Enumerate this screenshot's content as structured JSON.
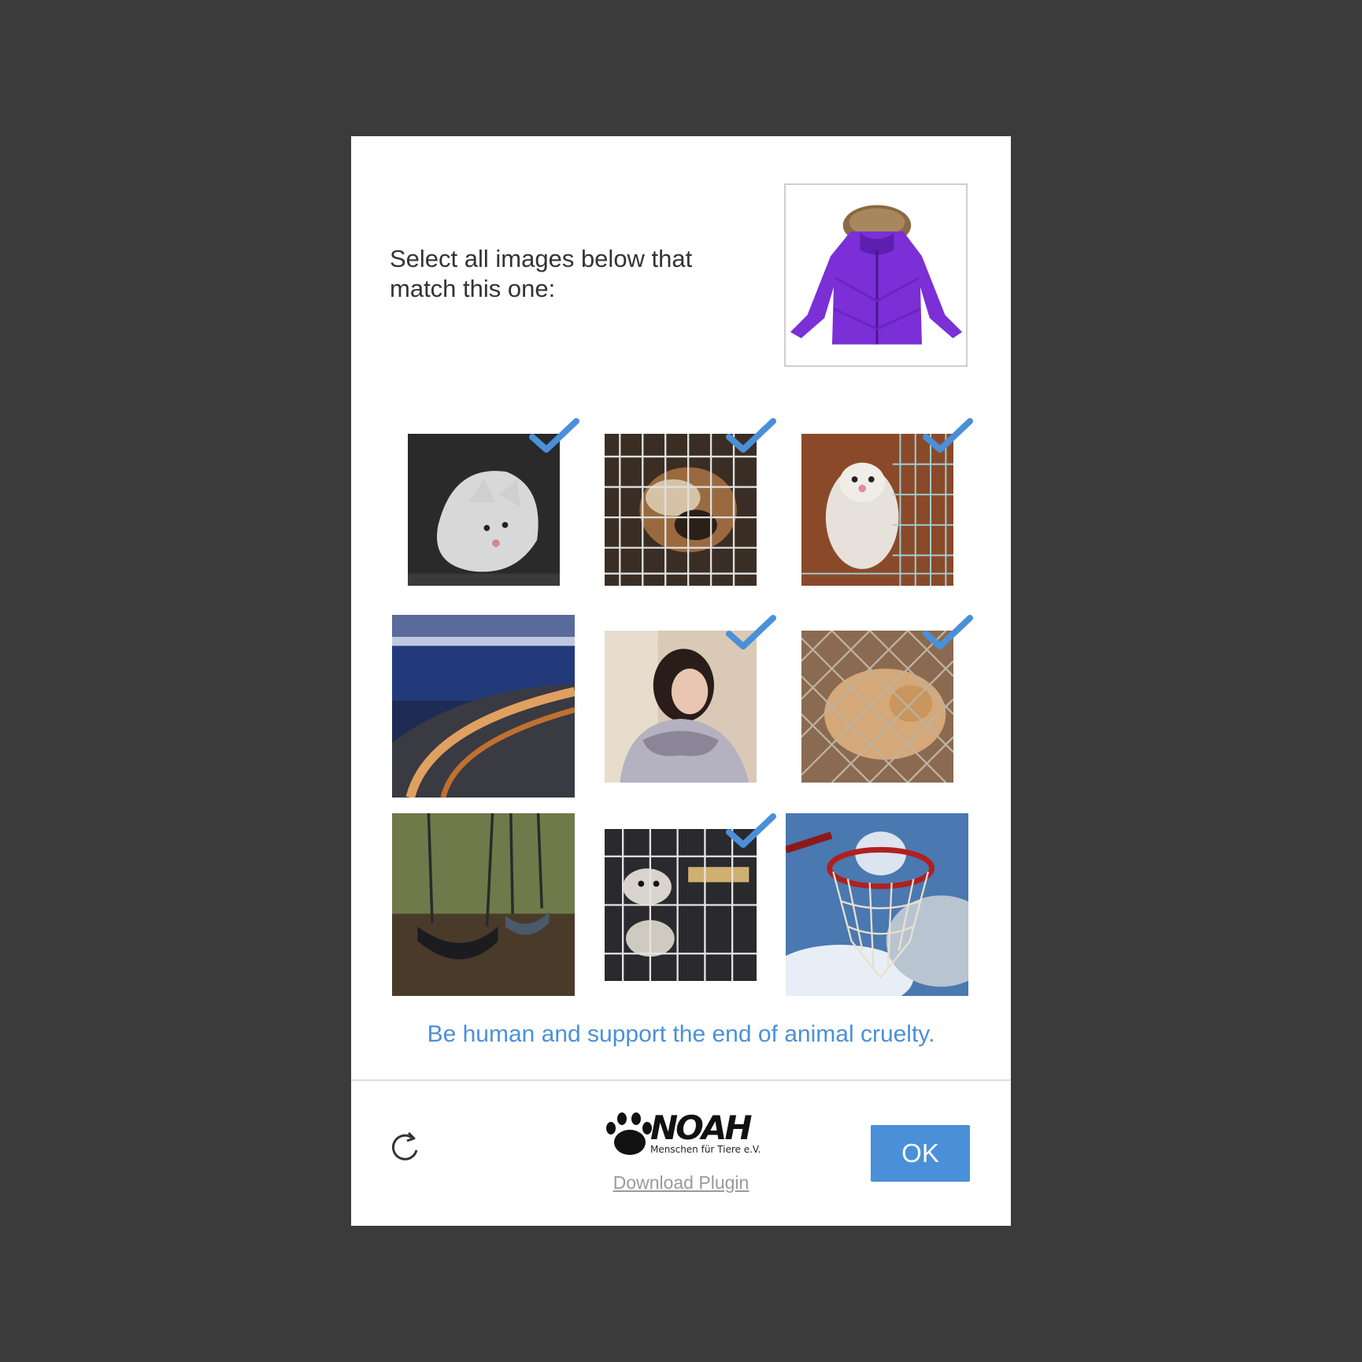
{
  "prompt": {
    "text": "Select all images below that match this one:"
  },
  "reference_image": {
    "subject": "purple-jacket-with-fur-hood",
    "icon": "jacket-icon"
  },
  "grid": {
    "tiles": [
      {
        "subject": "white-fox-in-cage",
        "selected": true
      },
      {
        "subject": "fox-behind-wire-cage",
        "selected": true
      },
      {
        "subject": "mink-in-wire-cage",
        "selected": true
      },
      {
        "subject": "highway-bridge-at-night",
        "selected": false
      },
      {
        "subject": "woman-in-fur-hooded-coat",
        "selected": true
      },
      {
        "subject": "raccoon-dog-in-wire-cage",
        "selected": true
      },
      {
        "subject": "empty-swings",
        "selected": false
      },
      {
        "subject": "minks-in-cage",
        "selected": true
      },
      {
        "subject": "basketball-hoop-sky",
        "selected": false
      }
    ],
    "check_color": "#4a90d9"
  },
  "tagline": "Be human and support the end of animal cruelty.",
  "footer": {
    "refresh_icon": "refresh-icon",
    "brand_name": "NOAH",
    "brand_subtitle": "Menschen für Tiere e.V.",
    "download_link": "Download Plugin",
    "ok_label": "OK",
    "accent_color": "#4a90d9"
  }
}
